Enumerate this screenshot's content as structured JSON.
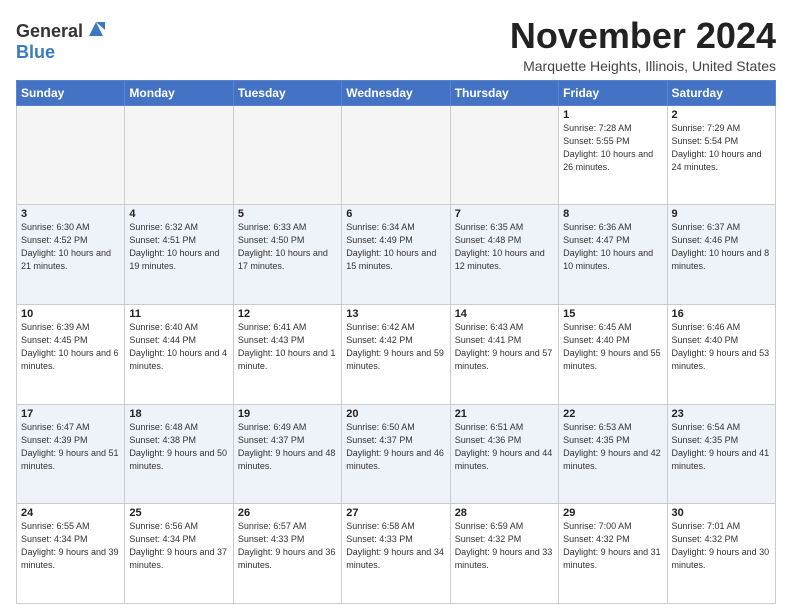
{
  "logo": {
    "general": "General",
    "blue": "Blue"
  },
  "header": {
    "month": "November 2024",
    "location": "Marquette Heights, Illinois, United States"
  },
  "weekdays": [
    "Sunday",
    "Monday",
    "Tuesday",
    "Wednesday",
    "Thursday",
    "Friday",
    "Saturday"
  ],
  "weeks": [
    [
      {
        "day": "",
        "info": ""
      },
      {
        "day": "",
        "info": ""
      },
      {
        "day": "",
        "info": ""
      },
      {
        "day": "",
        "info": ""
      },
      {
        "day": "",
        "info": ""
      },
      {
        "day": "1",
        "info": "Sunrise: 7:28 AM\nSunset: 5:55 PM\nDaylight: 10 hours and 26 minutes."
      },
      {
        "day": "2",
        "info": "Sunrise: 7:29 AM\nSunset: 5:54 PM\nDaylight: 10 hours and 24 minutes."
      }
    ],
    [
      {
        "day": "3",
        "info": "Sunrise: 6:30 AM\nSunset: 4:52 PM\nDaylight: 10 hours and 21 minutes."
      },
      {
        "day": "4",
        "info": "Sunrise: 6:32 AM\nSunset: 4:51 PM\nDaylight: 10 hours and 19 minutes."
      },
      {
        "day": "5",
        "info": "Sunrise: 6:33 AM\nSunset: 4:50 PM\nDaylight: 10 hours and 17 minutes."
      },
      {
        "day": "6",
        "info": "Sunrise: 6:34 AM\nSunset: 4:49 PM\nDaylight: 10 hours and 15 minutes."
      },
      {
        "day": "7",
        "info": "Sunrise: 6:35 AM\nSunset: 4:48 PM\nDaylight: 10 hours and 12 minutes."
      },
      {
        "day": "8",
        "info": "Sunrise: 6:36 AM\nSunset: 4:47 PM\nDaylight: 10 hours and 10 minutes."
      },
      {
        "day": "9",
        "info": "Sunrise: 6:37 AM\nSunset: 4:46 PM\nDaylight: 10 hours and 8 minutes."
      }
    ],
    [
      {
        "day": "10",
        "info": "Sunrise: 6:39 AM\nSunset: 4:45 PM\nDaylight: 10 hours and 6 minutes."
      },
      {
        "day": "11",
        "info": "Sunrise: 6:40 AM\nSunset: 4:44 PM\nDaylight: 10 hours and 4 minutes."
      },
      {
        "day": "12",
        "info": "Sunrise: 6:41 AM\nSunset: 4:43 PM\nDaylight: 10 hours and 1 minute."
      },
      {
        "day": "13",
        "info": "Sunrise: 6:42 AM\nSunset: 4:42 PM\nDaylight: 9 hours and 59 minutes."
      },
      {
        "day": "14",
        "info": "Sunrise: 6:43 AM\nSunset: 4:41 PM\nDaylight: 9 hours and 57 minutes."
      },
      {
        "day": "15",
        "info": "Sunrise: 6:45 AM\nSunset: 4:40 PM\nDaylight: 9 hours and 55 minutes."
      },
      {
        "day": "16",
        "info": "Sunrise: 6:46 AM\nSunset: 4:40 PM\nDaylight: 9 hours and 53 minutes."
      }
    ],
    [
      {
        "day": "17",
        "info": "Sunrise: 6:47 AM\nSunset: 4:39 PM\nDaylight: 9 hours and 51 minutes."
      },
      {
        "day": "18",
        "info": "Sunrise: 6:48 AM\nSunset: 4:38 PM\nDaylight: 9 hours and 50 minutes."
      },
      {
        "day": "19",
        "info": "Sunrise: 6:49 AM\nSunset: 4:37 PM\nDaylight: 9 hours and 48 minutes."
      },
      {
        "day": "20",
        "info": "Sunrise: 6:50 AM\nSunset: 4:37 PM\nDaylight: 9 hours and 46 minutes."
      },
      {
        "day": "21",
        "info": "Sunrise: 6:51 AM\nSunset: 4:36 PM\nDaylight: 9 hours and 44 minutes."
      },
      {
        "day": "22",
        "info": "Sunrise: 6:53 AM\nSunset: 4:35 PM\nDaylight: 9 hours and 42 minutes."
      },
      {
        "day": "23",
        "info": "Sunrise: 6:54 AM\nSunset: 4:35 PM\nDaylight: 9 hours and 41 minutes."
      }
    ],
    [
      {
        "day": "24",
        "info": "Sunrise: 6:55 AM\nSunset: 4:34 PM\nDaylight: 9 hours and 39 minutes."
      },
      {
        "day": "25",
        "info": "Sunrise: 6:56 AM\nSunset: 4:34 PM\nDaylight: 9 hours and 37 minutes."
      },
      {
        "day": "26",
        "info": "Sunrise: 6:57 AM\nSunset: 4:33 PM\nDaylight: 9 hours and 36 minutes."
      },
      {
        "day": "27",
        "info": "Sunrise: 6:58 AM\nSunset: 4:33 PM\nDaylight: 9 hours and 34 minutes."
      },
      {
        "day": "28",
        "info": "Sunrise: 6:59 AM\nSunset: 4:32 PM\nDaylight: 9 hours and 33 minutes."
      },
      {
        "day": "29",
        "info": "Sunrise: 7:00 AM\nSunset: 4:32 PM\nDaylight: 9 hours and 31 minutes."
      },
      {
        "day": "30",
        "info": "Sunrise: 7:01 AM\nSunset: 4:32 PM\nDaylight: 9 hours and 30 minutes."
      }
    ]
  ]
}
